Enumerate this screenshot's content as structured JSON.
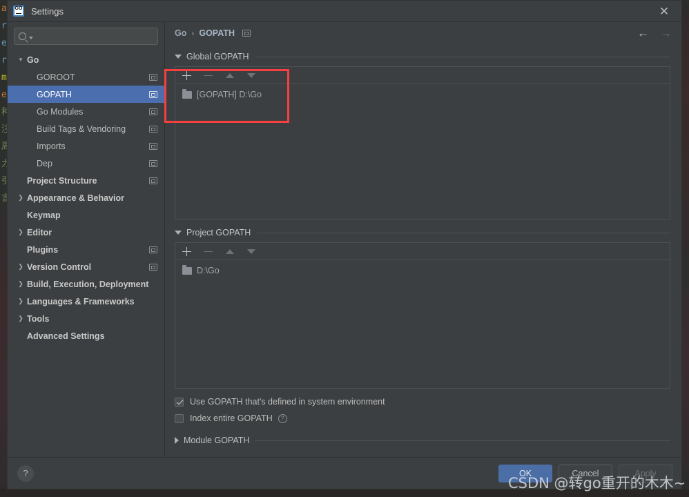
{
  "window": {
    "title": "Settings",
    "app_icon": "go-logo-icon",
    "close_icon": "close-icon"
  },
  "search": {
    "placeholder": "",
    "value": "",
    "icon": "search-icon"
  },
  "sidebar": {
    "items": [
      {
        "label": "Go",
        "level": 0,
        "arrow": "chevron-down",
        "bold": true,
        "cfg": false,
        "selected": false
      },
      {
        "label": "GOROOT",
        "level": 1,
        "arrow": "",
        "bold": false,
        "cfg": true,
        "selected": false
      },
      {
        "label": "GOPATH",
        "level": 1,
        "arrow": "",
        "bold": false,
        "cfg": true,
        "selected": true
      },
      {
        "label": "Go Modules",
        "level": 1,
        "arrow": "",
        "bold": false,
        "cfg": true,
        "selected": false
      },
      {
        "label": "Build Tags & Vendoring",
        "level": 1,
        "arrow": "",
        "bold": false,
        "cfg": true,
        "selected": false
      },
      {
        "label": "Imports",
        "level": 1,
        "arrow": "",
        "bold": false,
        "cfg": true,
        "selected": false
      },
      {
        "label": "Dep",
        "level": 1,
        "arrow": "",
        "bold": false,
        "cfg": true,
        "selected": false
      },
      {
        "label": "Project Structure",
        "level": 0,
        "arrow": "",
        "bold": true,
        "cfg": true,
        "selected": false
      },
      {
        "label": "Appearance & Behavior",
        "level": 0,
        "arrow": "chevron-right",
        "bold": true,
        "cfg": false,
        "selected": false
      },
      {
        "label": "Keymap",
        "level": 0,
        "arrow": "",
        "bold": true,
        "cfg": false,
        "selected": false
      },
      {
        "label": "Editor",
        "level": 0,
        "arrow": "chevron-right",
        "bold": true,
        "cfg": false,
        "selected": false
      },
      {
        "label": "Plugins",
        "level": 0,
        "arrow": "",
        "bold": true,
        "cfg": true,
        "selected": false
      },
      {
        "label": "Version Control",
        "level": 0,
        "arrow": "chevron-right",
        "bold": true,
        "cfg": true,
        "selected": false
      },
      {
        "label": "Build, Execution, Deployment",
        "level": 0,
        "arrow": "chevron-right",
        "bold": true,
        "cfg": false,
        "selected": false
      },
      {
        "label": "Languages & Frameworks",
        "level": 0,
        "arrow": "chevron-right",
        "bold": true,
        "cfg": false,
        "selected": false
      },
      {
        "label": "Tools",
        "level": 0,
        "arrow": "chevron-right",
        "bold": true,
        "cfg": false,
        "selected": false
      },
      {
        "label": "Advanced Settings",
        "level": 0,
        "arrow": "",
        "bold": true,
        "cfg": false,
        "selected": false
      }
    ]
  },
  "breadcrumb": {
    "root": "Go",
    "separator": "›",
    "current": "GOPATH",
    "config_icon": "module-config-icon",
    "back_icon": "←",
    "forward_icon": "→"
  },
  "main": {
    "global_gopath": {
      "title": "Global GOPATH",
      "expanded": true,
      "toolbar": {
        "add": "add-icon",
        "remove": "remove-icon",
        "move_up": "move-up-icon",
        "move_down": "move-down-icon"
      },
      "items": [
        {
          "label": "[GOPATH] D:\\Go",
          "icon": "folder-icon"
        }
      ]
    },
    "project_gopath": {
      "title": "Project GOPATH",
      "expanded": true,
      "toolbar": {
        "add": "add-icon",
        "remove": "remove-icon",
        "move_up": "move-up-icon",
        "move_down": "move-down-icon"
      },
      "items": [
        {
          "label": "D:\\Go",
          "icon": "folder-icon"
        }
      ]
    },
    "checkboxes": [
      {
        "label": "Use GOPATH that's defined in system environment",
        "checked": true,
        "help": false
      },
      {
        "label": "Index entire GOPATH",
        "checked": false,
        "help": true,
        "help_icon": "help-icon"
      }
    ],
    "module_gopath": {
      "title": "Module GOPATH",
      "expanded": false
    }
  },
  "footer": {
    "help_label": "?",
    "ok_label": "OK",
    "cancel_label": "Cancel",
    "apply_label": "Apply"
  },
  "annotation": {
    "color": "#f6403f",
    "target": "global-gopath-toolbar-and-entry"
  },
  "watermark": {
    "text": "CSDN @转go重开的木木~"
  },
  "background_editor": {
    "lines": [
      {
        "text": "a",
        "color": "#cc7832"
      },
      {
        "text": "r",
        "color": "#6897bb"
      },
      {
        "text": "e",
        "color": "#6897bb"
      },
      {
        "text": "r",
        "color": "#6897bb"
      },
      {
        "text": "m",
        "color": "#bbb529"
      },
      {
        "text": "e",
        "color": "#cc7832"
      },
      {
        "text": "",
        "color": "#a9b7c6"
      },
      {
        "text": "",
        "color": "#a9b7c6"
      },
      {
        "text": "",
        "color": "#a9b7c6"
      },
      {
        "text": "种",
        "color": "#6a8759"
      },
      {
        "text": "注",
        "color": "#6a8759"
      },
      {
        "text": "周",
        "color": "#6a8759"
      },
      {
        "text": "力",
        "color": "#6a8759"
      },
      {
        "text": "引",
        "color": "#6a8759"
      },
      {
        "text": "言",
        "color": "#6a8759"
      }
    ]
  }
}
